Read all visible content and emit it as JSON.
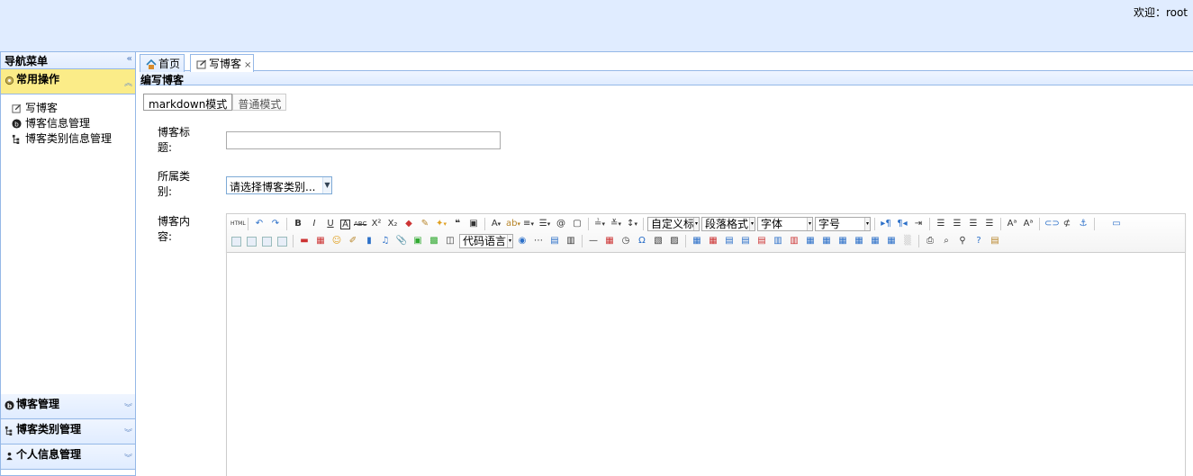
{
  "header": {
    "welcome": "欢迎：root"
  },
  "nav": {
    "title": "导航菜单",
    "collapse_icon": "«",
    "active_section": {
      "label": "常用操作",
      "icon": "gear-icon"
    },
    "items": [
      {
        "label": "写博客",
        "icon": "edit-icon"
      },
      {
        "label": "博客信息管理",
        "icon": "blog-icon"
      },
      {
        "label": "博客类别信息管理",
        "icon": "tree-icon"
      }
    ],
    "sections": [
      {
        "label": "博客管理",
        "icon": "blog-icon"
      },
      {
        "label": "博客类别管理",
        "icon": "tree-icon"
      },
      {
        "label": "个人信息管理",
        "icon": "user-icon"
      }
    ],
    "chev_up": "︽",
    "chev_down": "︾"
  },
  "tabs": [
    {
      "label": "首页",
      "icon": "home-icon"
    },
    {
      "label": "写博客",
      "icon": "edit-icon",
      "close": "×"
    }
  ],
  "panel": {
    "title": "编写博客"
  },
  "modes": [
    "markdown模式",
    "普通模式"
  ],
  "form": {
    "title_label": "博客标题:",
    "category_label": "所属类别:",
    "category_value": "请选择博客类别...",
    "content_label": "博客内容:"
  },
  "toolbar": {
    "font_style": "自定义标",
    "paragraph": "段落格式",
    "font_family": "字体",
    "font_size": "字号",
    "code_lang": "代码语言"
  },
  "colors": {
    "header_bg": "#e0ecff",
    "border": "#95b8e7",
    "active_section": "#fbec88"
  }
}
